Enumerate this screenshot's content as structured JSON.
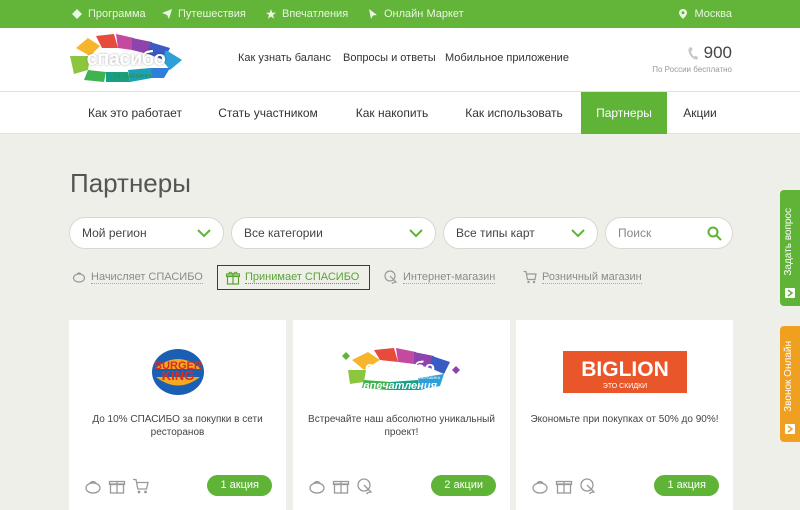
{
  "topbar": {
    "items": [
      {
        "label": "Программа",
        "icon": "diamond-icon"
      },
      {
        "label": "Путешествия",
        "icon": "paper-plane-icon"
      },
      {
        "label": "Впечатления",
        "icon": "star-icon"
      },
      {
        "label": "Онлайн Маркет",
        "icon": "cursor-icon"
      }
    ],
    "city": "Москва"
  },
  "header": {
    "logo_text": "спасибо",
    "logo_sub": "ОТ СБЕРБАНКА",
    "links": [
      "Как узнать баланс",
      "Вопросы и ответы",
      "Мобильное приложение"
    ],
    "phone": "900",
    "phone_sub": "По России бесплатно"
  },
  "nav": {
    "items": [
      "Как это работает",
      "Стать участником",
      "Как накопить",
      "Как использовать",
      "Партнеры",
      "Акции"
    ],
    "active": "Партнеры"
  },
  "page": {
    "title": "Партнеры",
    "filters": [
      "Мой регион",
      "Все категории",
      "Все типы карт"
    ],
    "search_placeholder": "Поиск",
    "legend": [
      "Начисляет СПАСИБО",
      "Принимает СПАСИБО",
      "Интернет-магазин",
      "Розничный магазин"
    ]
  },
  "cards": [
    {
      "logo_top": "BURGER",
      "logo_bottom": "KING",
      "desc": "До 10% СПАСИБО за покупки в сети ресторанов",
      "badge": "1 акция"
    },
    {
      "logo_top": "спасибо",
      "logo_small": "ОТ СБЕРБАНКА",
      "logo_bottom": "впечатления",
      "desc": "Встречайте наш абсолютно уникальный проект!",
      "badge": "2 акции"
    },
    {
      "logo_top": "BIGLION",
      "logo_bottom": "ЭТО СКИДКИ",
      "desc": "Экономьте при покупках от 50% до 90%!",
      "badge": "1 акция"
    }
  ],
  "side": {
    "ask": "Задать вопрос",
    "call": "Звонок Онлайн"
  },
  "colors": {
    "green": "#62b539",
    "orange": "#f0a020",
    "biglion": "#e8562a"
  }
}
